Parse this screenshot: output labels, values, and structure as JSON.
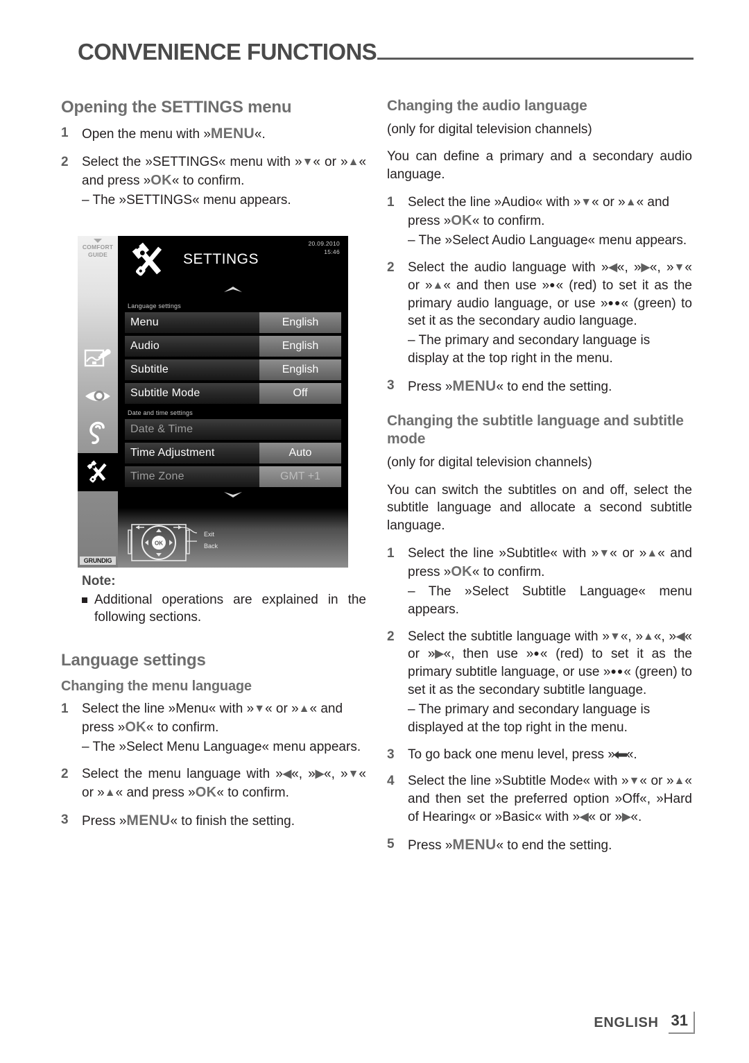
{
  "header": {
    "title": "CONVENIENCE FUNCTIONS"
  },
  "left_column": {
    "heading_opening": "Opening the SETTINGS menu",
    "steps_opening": [
      {
        "num": "1",
        "parts": [
          "Open the menu with »",
          "MENU",
          "«."
        ]
      },
      {
        "num": "2",
        "parts_a": [
          "Select the »SETTINGS« menu with »",
          "▼",
          "« or »",
          "▲",
          "« and press »",
          "OK",
          "« to confirm."
        ],
        "dash": "– The »SETTINGS« menu appears."
      }
    ],
    "note": {
      "title": "Note:",
      "text": "Additional operations are explained in the following sections."
    },
    "heading_language": "Language settings",
    "heading_menu_language": "Changing the menu language",
    "steps_menu_language": [
      {
        "num": "1",
        "text": "Select the line »Menu« with »▼« or »▲« and press »OK« to confirm.",
        "dash": "– The »Select Menu Language« menu appears."
      },
      {
        "num": "2",
        "text": "Select the menu language with »◀«, »▶«, »▼« or »▲« and press »OK« to confirm."
      },
      {
        "num": "3",
        "text": "Press »MENU« to finish the setting."
      }
    ]
  },
  "right_column": {
    "heading_audio": "Changing the audio language",
    "subtitle_audio": "(only for digital television channels)",
    "intro_audio": "You can define a primary and a secondary audio language.",
    "heading_subtitle": "Changing the subtitle language and subtitle mode",
    "subtitle_subtitle": "(only for digital television channels)",
    "intro_subtitle": "You can switch the subtitles on and off, select the subtitle language and allocate a second subtitle language."
  },
  "tv_figure": {
    "comfort_guide": {
      "line1": "COMFORT",
      "line2": "GUIDE"
    },
    "brand": "GRUNDIG",
    "title": "SETTINGS",
    "date": "20.09.2010",
    "time": "15:46",
    "group_language": "Language settings",
    "group_datetime": "Date and time settings",
    "rows": [
      {
        "label": "Menu",
        "value": "English",
        "dim": false,
        "full": false
      },
      {
        "label": "Audio",
        "value": "English",
        "dim": false,
        "full": false
      },
      {
        "label": "Subtitle",
        "value": "English",
        "dim": false,
        "full": false
      },
      {
        "label": "Subtitle Mode",
        "value": "Off",
        "dim": false,
        "full": false
      },
      {
        "label": "Date & Time",
        "value": "",
        "dim": true,
        "full": true
      },
      {
        "label": "Time Adjustment",
        "value": "Auto",
        "dim": false,
        "full": false
      },
      {
        "label": "Time Zone",
        "value": "GMT +1",
        "dim": true,
        "full": false
      }
    ],
    "remote": {
      "ok": "OK",
      "exit": "Exit",
      "back": "Back"
    }
  },
  "footer": {
    "language": "ENGLISH",
    "page": "31"
  },
  "colors": {
    "heading_gray": "#6e6e6e",
    "body_black": "#231f20",
    "rule_gray": "#5a5a5a",
    "tv_black": "#000000"
  }
}
